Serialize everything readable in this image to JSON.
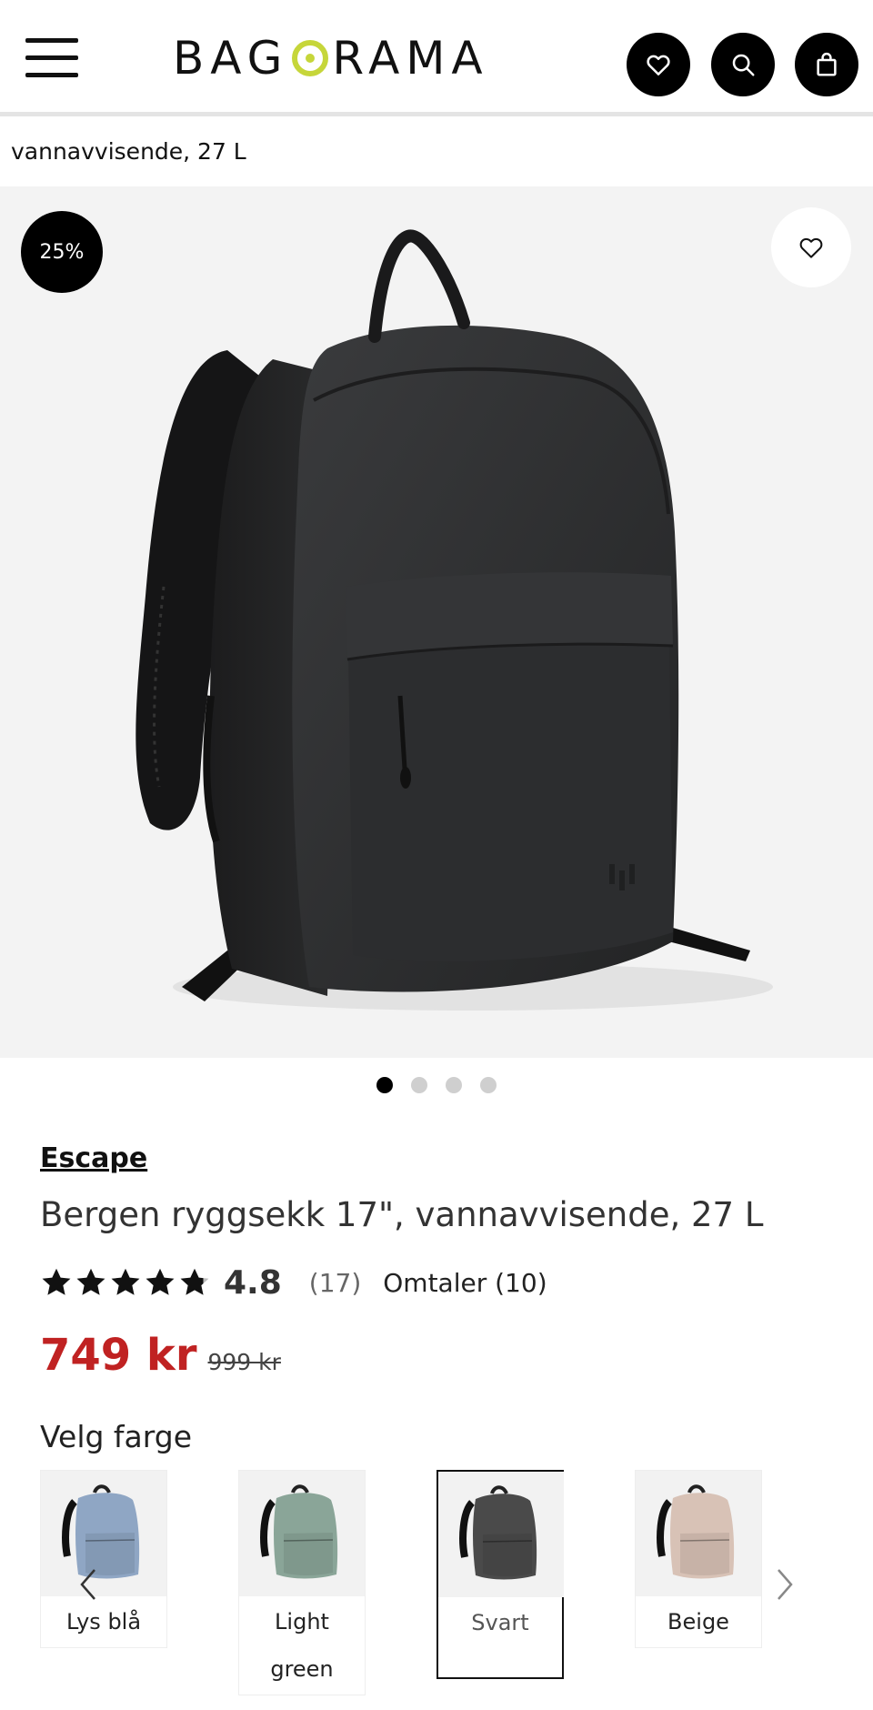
{
  "header": {
    "logo_text_left": "BAG",
    "logo_text_right": "RAMA"
  },
  "breadcrumb": "vannavvisende, 27 L",
  "gallery": {
    "discount_badge": "25%",
    "total_images": 4,
    "active_image": 1
  },
  "product": {
    "brand": "Escape",
    "title": "Bergen ryggsekk 17\", vannavvisende, 27 L",
    "rating": 4.8,
    "rating_text": "4.8",
    "rating_count": "(17)",
    "reviews_label": "Omtaler (10)",
    "price_now": "749 kr",
    "price_old": "999 kr"
  },
  "colors": {
    "label": "Velg farge",
    "options": [
      {
        "name": "Lys blå",
        "color": "#8fa6c4",
        "selected": false
      },
      {
        "name": "Light green",
        "color": "#8aa598",
        "selected": false
      },
      {
        "name": "Svart",
        "color": "#4a4a4a",
        "selected": true
      },
      {
        "name": "Beige",
        "color": "#d8c2b6",
        "selected": false
      }
    ]
  },
  "theme": {
    "accent": "#c6d63a",
    "sale_red": "#c02222"
  }
}
